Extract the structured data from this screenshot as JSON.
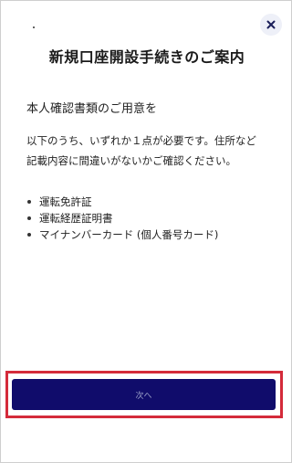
{
  "header": {
    "title": "新規口座開設手続きのご案内",
    "close_icon": "close-icon"
  },
  "content": {
    "subtitle": "本人確認書類のご用意を",
    "description": "以下のうち、いずれか１点が必要です。住所など記載内容に間違いがないかご確認ください。",
    "documents": [
      "運転免許証",
      "運転経歴証明書",
      "マイナンバーカード (個人番号カード)"
    ]
  },
  "footer": {
    "next_label": "次へ"
  },
  "colors": {
    "primary_button": "#100c6b",
    "highlight_border": "#d42b3a",
    "close_button_bg": "#eef0f8"
  }
}
